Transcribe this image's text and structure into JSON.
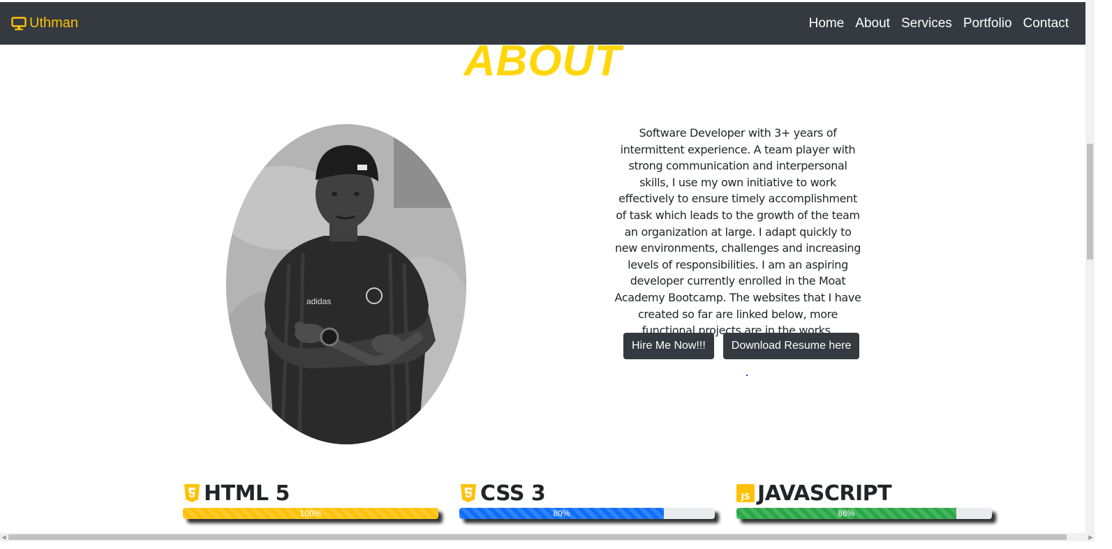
{
  "navbar": {
    "brand": "Uthman",
    "brand_icon": "monitor-icon",
    "links": [
      "Home",
      "About",
      "Services",
      "Portfolio",
      "Contact"
    ]
  },
  "about": {
    "title": "ABOUT",
    "bio": "Software Developer with 3+ years of intermittent experience. A team player with strong communication and interpersonal skills, I use my own initiative to work effectively to ensure timely accomplishment of task which leads to the growth of the team an organization at large. I adapt quickly to new environments, challenges and increasing levels of responsibilities. I am an aspiring developer currently enrolled in the Moat Academy Bootcamp. The websites that I have created so far are linked below, more functional projects are in the works.",
    "buttons": {
      "hire": "Hire Me Now!!!",
      "resume": "Download Resume here"
    },
    "photo_icon": "profile-photo"
  },
  "skills": [
    {
      "name": "HTML 5",
      "icon": "html5-icon",
      "percent": 100,
      "label": "100%",
      "color": "#ffc107"
    },
    {
      "name": "CSS 3",
      "icon": "css3-icon",
      "percent": 80,
      "label": "80%",
      "color": "#0d6efd"
    },
    {
      "name": "JAVASCRIPT",
      "icon": "javascript-icon",
      "percent": 86,
      "label": "86%",
      "color": "#28a745"
    }
  ],
  "colors": {
    "navbar_bg": "#343a40",
    "accent": "#ffc107",
    "title": "#ffd60a"
  }
}
